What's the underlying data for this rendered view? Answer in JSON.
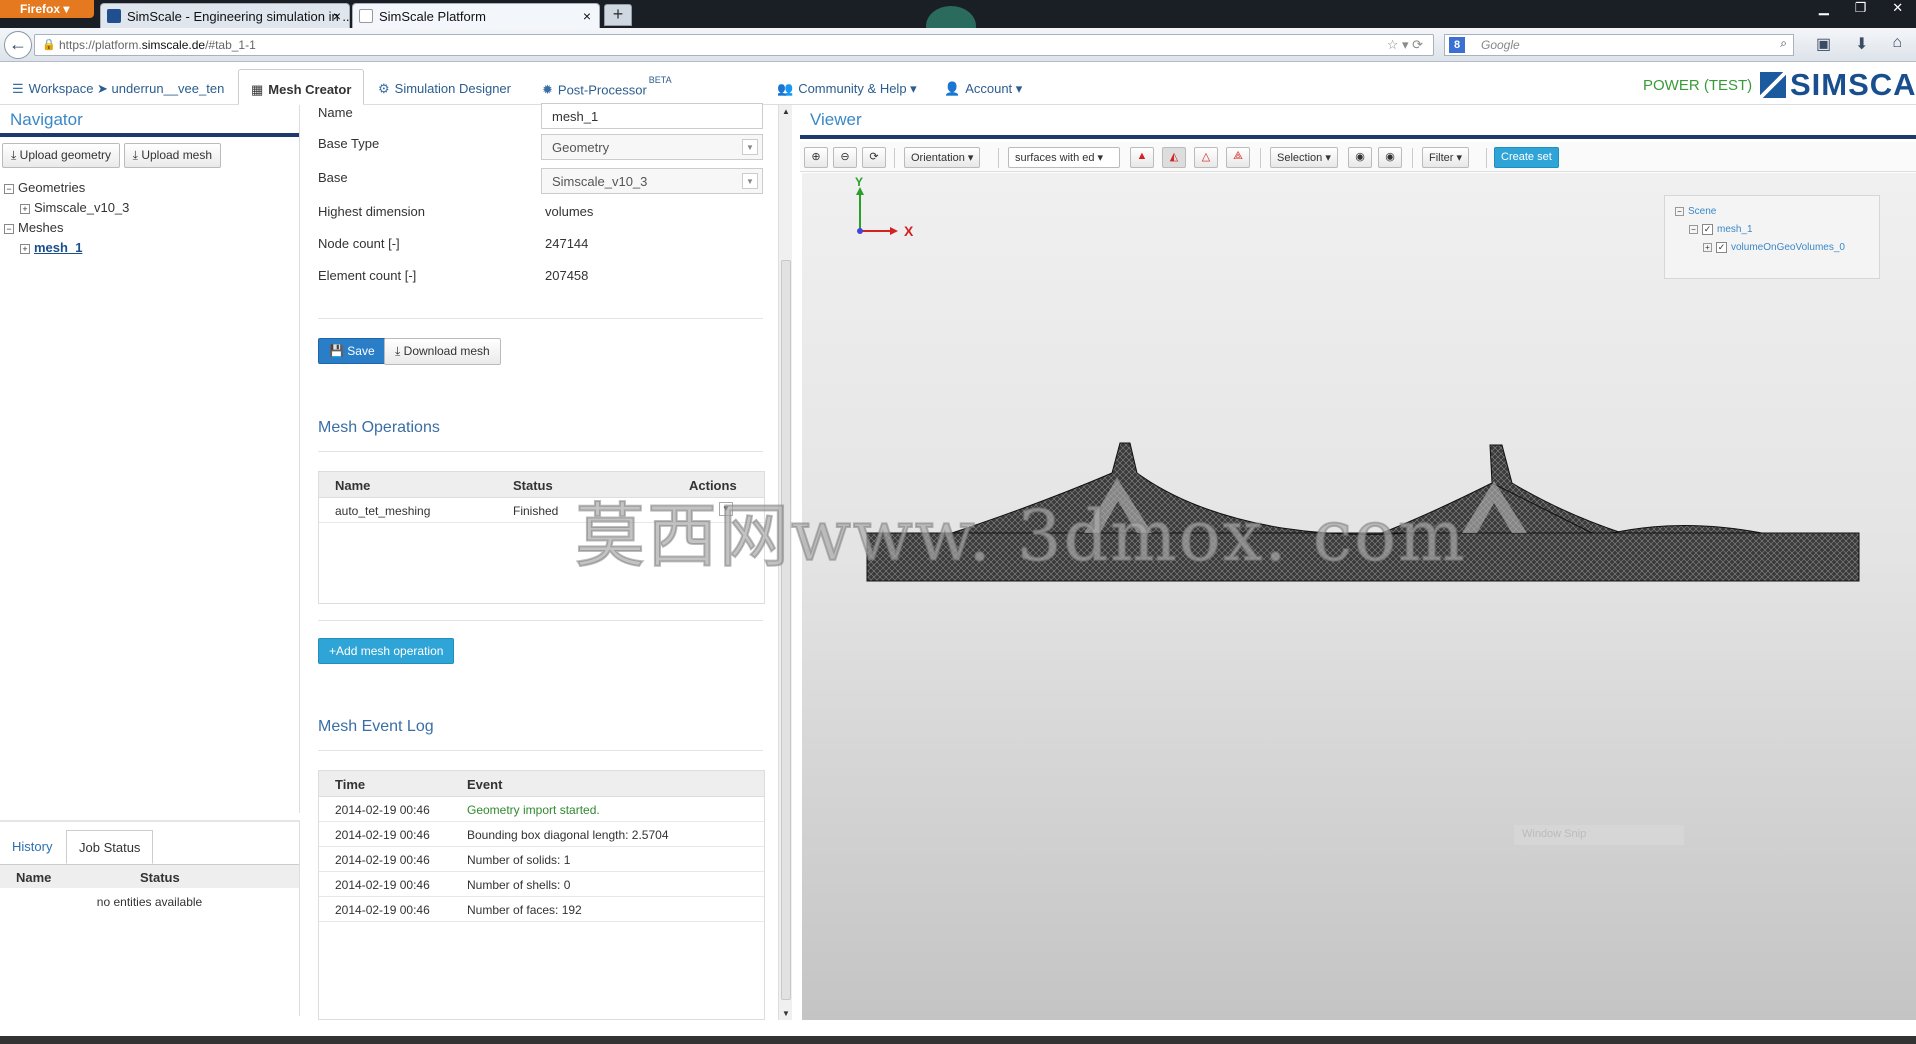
{
  "browser": {
    "app_button": "Firefox",
    "tabs": [
      {
        "title": "SimScale - Engineering simulation in ..."
      },
      {
        "title": "SimScale Platform"
      }
    ],
    "new_tab": "+",
    "url_prefix": "https://platform.",
    "url_domain": "simscale.de",
    "url_suffix": "/#tab_1-1",
    "search_placeholder": "Google",
    "search_engine_letter": "8"
  },
  "header": {
    "tabs": [
      {
        "label": "Workspace ➤ underrun__vee_ten",
        "icon": "workspace-icon"
      },
      {
        "label": "Mesh Creator",
        "icon": "grid-icon"
      },
      {
        "label": "Simulation Designer",
        "icon": "gears-icon"
      },
      {
        "label": "Post-Processor",
        "sup": "BETA",
        "icon": "palette-icon"
      },
      {
        "label": "Community & Help",
        "icon": "users-icon"
      },
      {
        "label": "Account",
        "icon": "user-icon"
      }
    ],
    "plan": "POWER (TEST)",
    "logo_text": "SIMSCALE"
  },
  "navigator": {
    "title": "Navigator",
    "upload_geometry": "Upload geometry",
    "upload_mesh": "Upload mesh",
    "tree": {
      "geometries": "Geometries",
      "geometry_item": "Simscale_v10_3",
      "meshes": "Meshes",
      "mesh_item": "mesh_1"
    }
  },
  "status_panel": {
    "tabs": [
      "History",
      "Job Status"
    ],
    "columns": [
      "Name",
      "Status"
    ],
    "empty": "no entities available"
  },
  "properties": {
    "name_label": "Name",
    "name_value": "mesh_1",
    "base_type_label": "Base Type",
    "base_type_value": "Geometry",
    "base_label": "Base",
    "base_value": "Simscale_v10_3",
    "highest_dim_label": "Highest dimension",
    "highest_dim_value": "volumes",
    "node_count_label": "Node count [-]",
    "node_count_value": "247144",
    "element_count_label": "Element count [-]",
    "element_count_value": "207458",
    "save": "Save",
    "download": "Download mesh"
  },
  "mesh_operations": {
    "title": "Mesh Operations",
    "columns": [
      "Name",
      "Status",
      "Actions"
    ],
    "rows": [
      {
        "name": "auto_tet_meshing",
        "status": "Finished"
      }
    ],
    "add_button": "Add mesh operation"
  },
  "event_log": {
    "title": "Mesh Event Log",
    "columns": [
      "Time",
      "Event"
    ],
    "rows": [
      {
        "time": "2014-02-19 00:46",
        "event": "Geometry import started."
      },
      {
        "time": "2014-02-19 00:46",
        "event": "Bounding box diagonal length: 2.5704"
      },
      {
        "time": "2014-02-19 00:46",
        "event": "Number of solids: 1"
      },
      {
        "time": "2014-02-19 00:46",
        "event": "Number of shells: 0"
      },
      {
        "time": "2014-02-19 00:46",
        "event": "Number of faces: 192"
      }
    ]
  },
  "viewer": {
    "title": "Viewer",
    "orientation": "Orientation",
    "render_mode": "surfaces with ed",
    "selection": "Selection",
    "filter": "Filter",
    "create_set": "Create set",
    "axis_y": "Y",
    "axis_x": "X",
    "scene_tree": {
      "root": "Scene",
      "mesh": "mesh_1",
      "volume": "volumeOnGeoVolumes_0"
    },
    "overlay": "Window Snip"
  },
  "watermark": "莫西网www. 3dmox. com",
  "colors": {
    "accent": "#2a7ec8",
    "title_blue": "#3a88c8",
    "plan_green": "#3a9a3a",
    "success_green": "#2e8b2e",
    "nav_bar": "#1c3a6e"
  }
}
